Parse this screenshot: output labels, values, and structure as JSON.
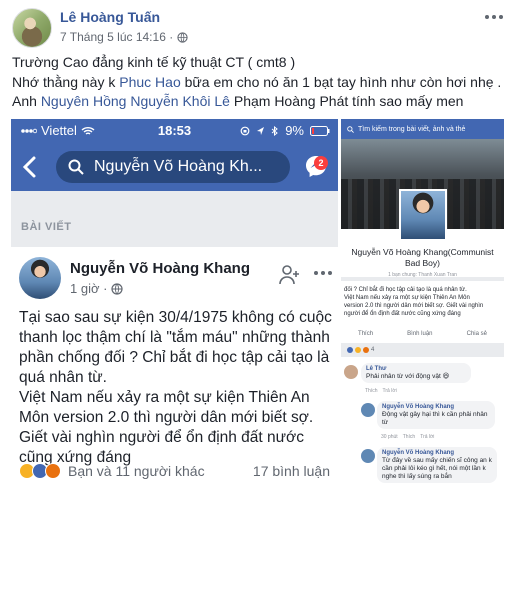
{
  "post": {
    "author": "Lê Hoàng Tuấn",
    "date": "7 Tháng 5 lúc 14:16 ·",
    "lines": [
      {
        "parts": [
          {
            "text": "Trường Cao đẳng kinh tế kỹ thuật CT ( cmt8 )",
            "link": false
          }
        ]
      },
      {
        "parts": [
          {
            "text": "Nhớ thằng này k ",
            "link": false
          },
          {
            "text": "Phuc Hao",
            "link": true
          },
          {
            "text": " bữa em cho nó ăn 1 bạt tay hình như còn hơi nhẹ .",
            "link": false
          }
        ]
      },
      {
        "parts": [
          {
            "text": "Anh ",
            "link": false
          },
          {
            "text": "Nguyên Hồng",
            "link": true
          },
          {
            "text": " ",
            "link": false
          },
          {
            "text": "Nguyễn Khôi Lê",
            "link": true
          },
          {
            "text": " Phạm Hoàng Phát tính sao mấy men",
            "link": false
          }
        ]
      }
    ]
  },
  "screenshot_main": {
    "carrier": "Viettel",
    "time": "18:53",
    "battery": "9%",
    "search_text": "Nguyễn Võ Hoàng Kh...",
    "messenger_badge": "2",
    "section_label": "BÀI VIẾT",
    "inner_author": "Nguyễn Võ Hoàng Khang",
    "inner_time": "1 giờ ·",
    "inner_lines": [
      "Tại sao sau sự kiện 30/4/1975 không có cuộc",
      "thanh lọc thậm chí là \"tắm máu\" những thành",
      "phần chống đối ? Chỉ bắt đi học tập cải tạo là",
      "quá nhân từ.",
      "Việt Nam nếu xảy ra một sự kiện Thiên An",
      "Môn version 2.0 thì người dân mới biết sợ.",
      "Giết vài nghìn người để ổn định đất nước",
      "cũng xứng đáng"
    ],
    "reactions_text": "Bạn và 11 người khác",
    "comments_text": "17 bình luận"
  },
  "screenshot_side": {
    "search_text": "Tìm kiếm trong bài viết, ảnh và thẻ",
    "profile_name": "Nguyễn Võ Hoàng Khang(Communist Bad Boy)",
    "friends_text": "1 bạn chung: Thanh Xuan Tran",
    "post_lines": [
      "đối ? Chỉ bắt đi học tập cải tạo là quá nhân từ.",
      "Việt Nam nếu xảy ra một sự kiện Thiên An Môn",
      "version 2.0 thì người dân mới biết sợ. Giết vài nghìn",
      "người để ổn định đất nước cũng xứng đáng"
    ],
    "action_like": "Thích",
    "action_comment": "Bình luận",
    "action_share": "Chia sẻ",
    "reaction_count": "4",
    "comments": [
      {
        "name": "Lê Thư",
        "text": "Phải nhân từ với động vật 😆",
        "meta": [
          "Thích",
          "Trả lời"
        ]
      },
      {
        "name": "Nguyễn Võ Hoàng Khang",
        "text": "Động vật gây hại thì k cần phải nhân từ",
        "meta": [
          "30 phút",
          "Thích",
          "Trả lời"
        ]
      },
      {
        "name": "Nguyễn Võ Hoàng Khang",
        "text": "Từ đây về sau mấy chiến sĩ công an k cần phải lôi kéo gì hết, nói một lần k nghe thì lấy súng ra bắn",
        "meta": []
      }
    ]
  },
  "colors": {
    "facebook_blue": "#4267b2",
    "link_blue": "#385898",
    "badge_red": "#fa3e3e"
  }
}
